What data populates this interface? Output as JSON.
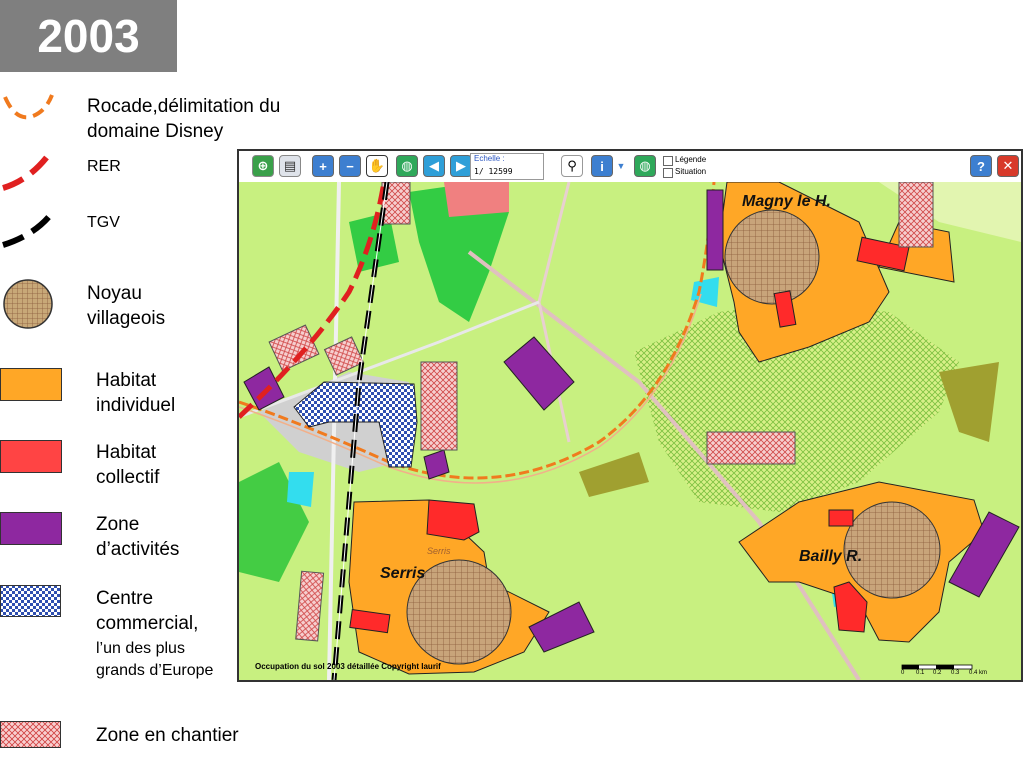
{
  "year": "2003",
  "legend": {
    "rocade": "Rocade,délimitation du domaine Disney",
    "rer": "RER",
    "tgv": "TGV",
    "noyau": "Noyau villageois",
    "habitat_individuel": "Habitat individuel",
    "habitat_collectif": "Habitat collectif",
    "zone_activites": "Zone d’activités",
    "centre_commercial_main": "Centre commercial,",
    "centre_commercial_note": "l’un des plus grands d’Europe",
    "zone_chantier": "Zone en chantier"
  },
  "colors": {
    "rocade": "#f07a1e",
    "rer": "#e02020",
    "tgv": "#000000",
    "habitat_individuel": "#ffa726",
    "habitat_collectif": "#ff2a2a",
    "zone_activites": "#8e28a0",
    "centre_commercial": "#3355bb",
    "zone_chantier": "#f8c8c8",
    "noyau": "#c8a878",
    "vegetation": "#c8f080",
    "forest": "#33cc33",
    "water": "#33ddee"
  },
  "map": {
    "toolbar": {
      "scale_label": "Echelle :",
      "scale_prefix": "1/",
      "scale_value": "12599",
      "legend_toggle": "Légende",
      "situation_toggle": "Situation",
      "icons": [
        "globe-icon",
        "print-icon",
        "zoom-in-icon",
        "zoom-out-icon",
        "pan-hand-icon",
        "world-icon",
        "zoom-back-icon",
        "zoom-next-icon",
        "binoculars-icon",
        "info-icon",
        "world-locate-icon",
        "help-icon",
        "close-icon"
      ]
    },
    "caption": "Occupation du sol 2003 détaillée Copyright Iaurif",
    "scale_ticks": [
      "0",
      "0.1",
      "0.2",
      "0.3",
      "0.4 km"
    ],
    "places": {
      "magny": "Magny le H.",
      "serris": "Serris",
      "serris_small": "Serris",
      "bailly": "Bailly R."
    }
  }
}
